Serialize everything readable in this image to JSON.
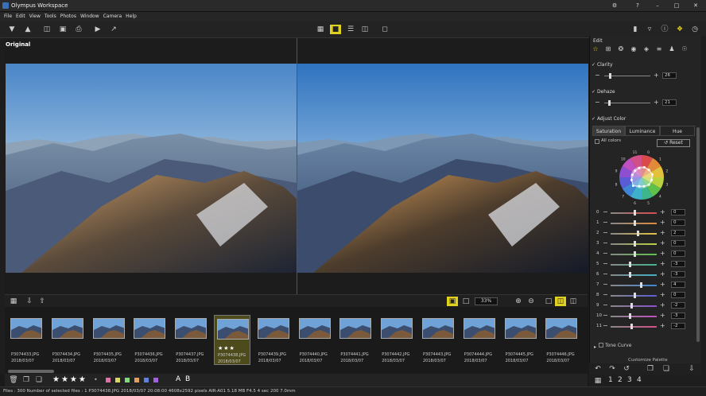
{
  "title": "Olympus Workspace",
  "window_buttons": {
    "help": "?",
    "minimize": "–",
    "maximize": "□",
    "close": "✕",
    "settings": "⚙"
  },
  "menu": [
    "File",
    "Edit",
    "View",
    "Tools",
    "Photos",
    "Window",
    "Camera",
    "Help"
  ],
  "viewer": {
    "label": "Original",
    "zoom": "33%"
  },
  "panel": {
    "title": "Edit",
    "clarity": {
      "label": "Clarity",
      "value": "26",
      "fraction": 0.1
    },
    "dehaze": {
      "label": "Dehaze",
      "value": "21",
      "fraction": 0.08
    },
    "adjust_color": {
      "label": "Adjust Color",
      "tabs": [
        "Saturation",
        "Luminance",
        "Hue"
      ],
      "all_colors": "All colors",
      "reset": "Reset"
    },
    "wheel_labels": [
      "0",
      "1",
      "2",
      "3",
      "4",
      "5",
      "6",
      "7",
      "8",
      "9",
      "10",
      "11"
    ],
    "color_rows": [
      {
        "label": "0",
        "value": "0",
        "fraction": 0.5,
        "color": "#d94a4a"
      },
      {
        "label": "1",
        "value": "0",
        "fraction": 0.5,
        "color": "#e08a3a"
      },
      {
        "label": "2",
        "value": "2",
        "fraction": 0.57,
        "color": "#e3c13d"
      },
      {
        "label": "3",
        "value": "0",
        "fraction": 0.5,
        "color": "#b9d23d"
      },
      {
        "label": "4",
        "value": "0",
        "fraction": 0.5,
        "color": "#5fc04a"
      },
      {
        "label": "5",
        "value": "-3",
        "fraction": 0.4,
        "color": "#3fb58c"
      },
      {
        "label": "6",
        "value": "-3",
        "fraction": 0.4,
        "color": "#3fb0c9"
      },
      {
        "label": "7",
        "value": "4",
        "fraction": 0.64,
        "color": "#3f86d6"
      },
      {
        "label": "8",
        "value": "0",
        "fraction": 0.5,
        "color": "#5a5cd6"
      },
      {
        "label": "9",
        "value": "-2",
        "fraction": 0.43,
        "color": "#8c4fd0"
      },
      {
        "label": "10",
        "value": "-3",
        "fraction": 0.4,
        "color": "#c04fc0"
      },
      {
        "label": "11",
        "value": "-2",
        "fraction": 0.43,
        "color": "#d24f88"
      }
    ],
    "tone_curve": "Tone Curve",
    "customize_palette": "Customize Palette"
  },
  "thumbnails": [
    {
      "file": "P3074433.JPG",
      "date": "2018/03/07"
    },
    {
      "file": "P3074434.JPG",
      "date": "2018/03/07"
    },
    {
      "file": "P3074435.JPG",
      "date": "2018/03/07"
    },
    {
      "file": "P3074436.JPG",
      "date": "2018/03/07"
    },
    {
      "file": "P3074437.JPG",
      "date": "2018/03/07"
    },
    {
      "file": "P3074438.JPG",
      "date": "2018/03/07",
      "selected": true,
      "rating": 3
    },
    {
      "file": "P3074439.JPG",
      "date": "2018/03/07"
    },
    {
      "file": "P3074440.JPG",
      "date": "2018/03/07"
    },
    {
      "file": "P3074441.JPG",
      "date": "2018/03/07"
    },
    {
      "file": "P3074442.JPG",
      "date": "2018/03/07"
    },
    {
      "file": "P3074443.JPG",
      "date": "2018/03/07"
    },
    {
      "file": "P3074444.JPG",
      "date": "2018/03/07"
    },
    {
      "file": "P3074445.JPG",
      "date": "2018/03/07"
    },
    {
      "file": "P3074446.JPG",
      "date": "2018/03/07"
    }
  ],
  "bottombar": {
    "stars": "★★★★",
    "dot": "•",
    "a": "A",
    "b": "B",
    "pages": [
      "1",
      "2",
      "3",
      "4"
    ]
  },
  "label_colors": [
    "#e070a8",
    "#d8d860",
    "#80d880",
    "#e0a060",
    "#6080e0",
    "#a060e0"
  ],
  "status": "Files : 300  Number of selected files : 1  P3074438.JPG  2018/03/07 20:08:00  4608x2592 pixels  AIR-A01  5.18 MB  F4.5  4 sec  200  7.0mm"
}
